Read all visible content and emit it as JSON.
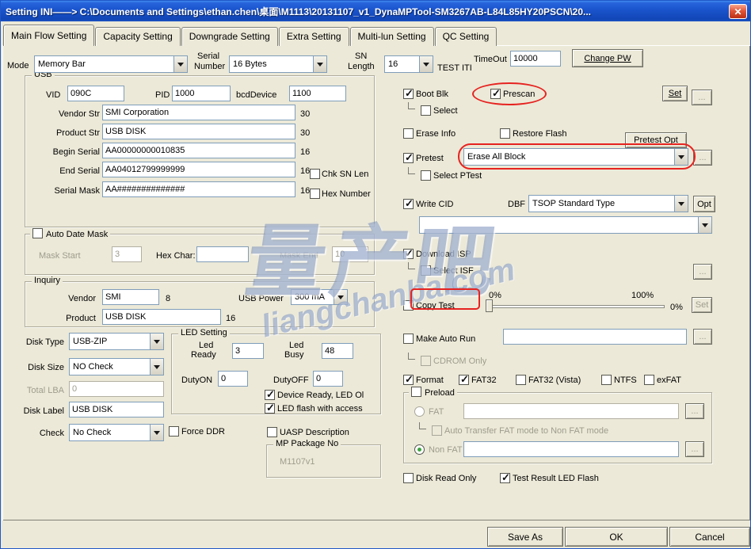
{
  "window": {
    "title": "Setting  INI——>  C:\\Documents and Settings\\ethan.chen\\桌面\\M1113\\20131107_v1_DynaMPTool-SM3267AB-L84L85HY20PSCN\\20..."
  },
  "icons": {
    "close": "✕"
  },
  "tabs": [
    "Main Flow Setting",
    "Capacity Setting",
    "Downgrade Setting",
    "Extra Setting",
    "Multi-lun Setting",
    "QC Setting"
  ],
  "topbar": {
    "mode_label": "Mode",
    "mode_value": "Memory Bar",
    "serial_label_1": "Serial",
    "serial_label_2": "Number",
    "serial_value": "16 Bytes",
    "sn_label_1": "SN",
    "sn_label_2": "Length",
    "sn_value": "16",
    "test_iti": "TEST ITI",
    "timeout_label": "TimeOut",
    "timeout_value": "10000",
    "change_pw": "Change PW"
  },
  "usb": {
    "caption": "USB",
    "vid_label": "VID",
    "vid": "090C",
    "pid_label": "PID",
    "pid": "1000",
    "bcd_label": "bcdDevice",
    "bcd": "1100",
    "vendor_str_label": "Vendor Str",
    "vendor_str": "SMI Corporation",
    "vendor_str_len": "30",
    "product_str_label": "Product Str",
    "product_str": "USB DISK",
    "product_str_len": "30",
    "begin_serial_label": "Begin Serial",
    "begin_serial": "AA00000000010835",
    "begin_serial_len": "16",
    "end_serial_label": "End Serial",
    "end_serial": "AA04012799999999",
    "end_serial_len": "16",
    "chk_sn_len": "Chk SN Len",
    "serial_mask_label": "Serial Mask",
    "serial_mask": "AA##############",
    "serial_mask_len": "16",
    "hex_number": "Hex Number"
  },
  "auto_date_mask": {
    "caption": "Auto Date Mask",
    "mask_start_label": "Mask Start",
    "mask_start": "3",
    "hex_char_label": "Hex Char:",
    "hex_char": "",
    "mask_end_label": "Mask End",
    "mask_end": "10"
  },
  "inquiry": {
    "caption": "Inquiry",
    "vendor_label": "Vendor",
    "vendor": "SMI",
    "vendor_len": "8",
    "usb_power_label": "USB Power",
    "usb_power": "300 mA",
    "product_label": "Product",
    "product": "USB DISK",
    "product_len": "16"
  },
  "disk": {
    "disk_type_label": "Disk Type",
    "disk_type": "USB-ZIP",
    "disk_size_label": "Disk Size",
    "disk_size": "NO Check",
    "total_lba_label": "Total LBA",
    "total_lba": "0",
    "disk_label_label": "Disk Label",
    "disk_label": "USB DISK",
    "check_label": "Check",
    "check": "No Check",
    "force_ddr": "Force DDR"
  },
  "led": {
    "caption": "LED Setting",
    "ready_1": "Led",
    "ready_2": "Ready",
    "ready": "3",
    "busy_1": "Led",
    "busy_2": "Busy",
    "busy": "48",
    "duty_on_label": "DutyON",
    "duty_on": "0",
    "duty_off_label": "DutyOFF",
    "duty_off": "0",
    "device_ready": "Device Ready, LED Ol",
    "flash_access": "LED flash with access"
  },
  "misc": {
    "uasp": "UASP Description",
    "mp_caption": "MP Package No",
    "mp_value": "M1107v1"
  },
  "right": {
    "boot_blk": "Boot Blk",
    "prescan": "Prescan",
    "set_btn": "Set",
    "dots": "...",
    "select": "Select",
    "erase_info": "Erase Info",
    "restore_flash": "Restore Flash",
    "pretest_opt": "Pretest Opt",
    "pretest": "Pretest",
    "pretest_value": "Erase All Block",
    "select_ptest": "Select PTest",
    "write_cid": "Write CID",
    "dbf": "DBF",
    "dbf_value": "TSOP Standard Type",
    "dbf_value2": "",
    "opt_btn": "Opt",
    "download_isp": "Download ISP",
    "select_isf": "Select ISF",
    "copy_test": "Copy Test",
    "pct_0": "0%",
    "pct_100": "100%",
    "pct_cur": "0%",
    "set_btn2": "Set",
    "make_auto_run": "Make Auto Run",
    "make_auto_run_value": "",
    "cdrom_only": "CDROM Only",
    "format": "Format",
    "fat32": "FAT32",
    "fat32_vista": "FAT32 (Vista)",
    "ntfs": "NTFS",
    "exfat": "exFAT",
    "preload_caption": "Preload",
    "fat": "FAT",
    "fat_path": "",
    "auto_transfer": "Auto Transfer FAT mode to Non FAT mode",
    "non_fat": "Non FAT",
    "non_fat_path": "",
    "disk_read_only": "Disk Read Only",
    "test_result": "Test Result LED Flash"
  },
  "bottom": {
    "save_as": "Save  As",
    "ok": "OK",
    "cancel": "Cancel"
  },
  "watermark": {
    "main": "量产吧",
    "sub": "liangchanba.com"
  }
}
